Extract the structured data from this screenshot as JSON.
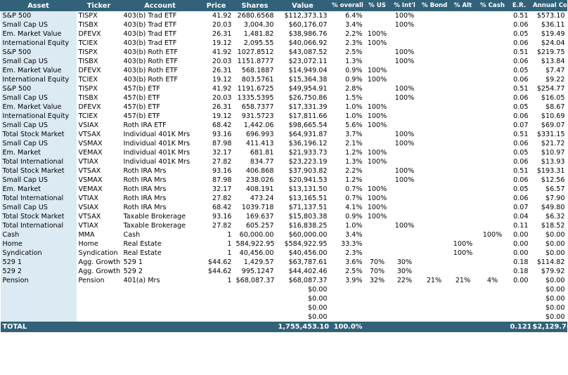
{
  "headers": [
    "Asset",
    "Ticker",
    "Account",
    "Price",
    "Shares",
    "Value",
    "% overall",
    "% US",
    "% Int'l",
    "% Bond",
    "% Alt",
    "% Cash",
    "E.R.",
    "Annual Cost"
  ],
  "rows": [
    [
      "S&P 500",
      "TISPX",
      "403(b) Trad ETF",
      "41.92",
      "2680.6568",
      "$112,373.13",
      "6.4%",
      "",
      "100%",
      "",
      "",
      "",
      "0.51",
      "$573.10"
    ],
    [
      "Small Cap US",
      "TISBX",
      "403(b) Trad ETF",
      "20.03",
      "3,004.30",
      "$60,176.07",
      "3.4%",
      "",
      "100%",
      "",
      "",
      "",
      "0.06",
      "$36.11"
    ],
    [
      "Em. Market Value",
      "DFEVX",
      "403(b) Trad ETF",
      "26.31",
      "1,481.82",
      "$38,986.76",
      "2.2%",
      "100%",
      "",
      "",
      "",
      "",
      "0.05",
      "$19.49"
    ],
    [
      "International Equity",
      "TCIEX",
      "403(b) Trad ETF",
      "19.12",
      "2,095.55",
      "$40,066.92",
      "2.3%",
      "100%",
      "",
      "",
      "",
      "",
      "0.06",
      "$24.04"
    ],
    [
      "S&P 500",
      "TISPX",
      "403(b) Roth ETF",
      "41.92",
      "1027.8512",
      "$43,087.52",
      "2.5%",
      "",
      "100%",
      "",
      "",
      "",
      "0.51",
      "$219.75"
    ],
    [
      "Small Cap US",
      "TISBX",
      "403(b) Roth ETF",
      "20.03",
      "1151.8777",
      "$23,072.11",
      "1.3%",
      "",
      "100%",
      "",
      "",
      "",
      "0.06",
      "$13.84"
    ],
    [
      "Em. Market Value",
      "DFEVX",
      "403(b) Roth ETF",
      "26.31",
      "568.1887",
      "$14,949.04",
      "0.9%",
      "100%",
      "",
      "",
      "",
      "",
      "0.05",
      "$7.47"
    ],
    [
      "International Equity",
      "TCIEX",
      "403(b) Roth ETF",
      "19.12",
      "803.5761",
      "$15,364.38",
      "0.9%",
      "100%",
      "",
      "",
      "",
      "",
      "0.06",
      "$9.22"
    ],
    [
      "S&P 500",
      "TISPX",
      "457(b) ETF",
      "41.92",
      "1191.6725",
      "$49,954.91",
      "2.8%",
      "",
      "100%",
      "",
      "",
      "",
      "0.51",
      "$254.77"
    ],
    [
      "Small Cap US",
      "TISBX",
      "457(b) ETF",
      "20.03",
      "1335.5395",
      "$26,750.86",
      "1.5%",
      "",
      "100%",
      "",
      "",
      "",
      "0.06",
      "$16.05"
    ],
    [
      "Em. Market Value",
      "DFEVX",
      "457(b) ETF",
      "26.31",
      "658.7377",
      "$17,331.39",
      "1.0%",
      "100%",
      "",
      "",
      "",
      "",
      "0.05",
      "$8.67"
    ],
    [
      "International Equity",
      "TCIEX",
      "457(b) ETF",
      "19.12",
      "931.5723",
      "$17,811.66",
      "1.0%",
      "100%",
      "",
      "",
      "",
      "",
      "0.06",
      "$10.69"
    ],
    [
      "Small Cap US",
      "VSIAX",
      "Roth IRA ETF",
      "68.42",
      "1,442.06",
      "$98,665.54",
      "5.6%",
      "100%",
      "",
      "",
      "",
      "",
      "0.07",
      "$69.07"
    ],
    [
      "Total Stock Market",
      "VTSAX",
      "Individual 401K Mrs",
      "93.16",
      "696.993",
      "$64,931.87",
      "3.7%",
      "",
      "100%",
      "",
      "",
      "",
      "0.51",
      "$331.15"
    ],
    [
      "Small Cap US",
      "VSMAX",
      "Individual 401K Mrs",
      "87.98",
      "411.413",
      "$36,196.12",
      "2.1%",
      "",
      "100%",
      "",
      "",
      "",
      "0.06",
      "$21.72"
    ],
    [
      "Em. Market",
      "VEMAX",
      "Individual 401K Mrs",
      "32.17",
      "681.81",
      "$21,933.73",
      "1.2%",
      "100%",
      "",
      "",
      "",
      "",
      "0.05",
      "$10.97"
    ],
    [
      "Total International",
      "VTIAX",
      "Individual 401K Mrs",
      "27.82",
      "834.77",
      "$23,223.19",
      "1.3%",
      "100%",
      "",
      "",
      "",
      "",
      "0.06",
      "$13.93"
    ],
    [
      "Total Stock Market",
      "VTSAX",
      "Roth IRA Mrs",
      "93.16",
      "406.868",
      "$37,903.82",
      "2.2%",
      "",
      "100%",
      "",
      "",
      "",
      "0.51",
      "$193.31"
    ],
    [
      "Small Cap US",
      "VSMAX",
      "Roth IRA Mrs",
      "87.98",
      "238.026",
      "$20,941.53",
      "1.2%",
      "",
      "100%",
      "",
      "",
      "",
      "0.06",
      "$12.56"
    ],
    [
      "Em. Market",
      "VEMAX",
      "Roth IRA Mrs",
      "32.17",
      "408.191",
      "$13,131.50",
      "0.7%",
      "100%",
      "",
      "",
      "",
      "",
      "0.05",
      "$6.57"
    ],
    [
      "Total International",
      "VTIAX",
      "Roth IRA Mrs",
      "27.82",
      "473.24",
      "$13,165.51",
      "0.7%",
      "100%",
      "",
      "",
      "",
      "",
      "0.06",
      "$7.90"
    ],
    [
      "Small Cap US",
      "VSIAX",
      "Roth IRA Mrs",
      "68.42",
      "1039.718",
      "$71,137.51",
      "4.1%",
      "100%",
      "",
      "",
      "",
      "",
      "0.07",
      "$49.80"
    ],
    [
      "Total Stock Market",
      "VTSAX",
      "Taxable Brokerage",
      "93.16",
      "169.637",
      "$15,803.38",
      "0.9%",
      "100%",
      "",
      "",
      "",
      "",
      "0.04",
      "$6.32"
    ],
    [
      "Total International",
      "VTIAX",
      "Taxable Brokerage",
      "27.82",
      "605.257",
      "$16,838.25",
      "1.0%",
      "",
      "100%",
      "",
      "",
      "",
      "0.11",
      "$18.52"
    ],
    [
      "Cash",
      "MMA",
      "Cash",
      "1",
      "60,000.00",
      "$60,000.00",
      "3.4%",
      "",
      "",
      "",
      "",
      "100%",
      "0.00",
      "$0.00"
    ],
    [
      "Home",
      "Home",
      "Real Estate",
      "1",
      "584,922.95",
      "$584,922.95",
      "33.3%",
      "",
      "",
      "",
      "100%",
      "",
      "0.00",
      "$0.00"
    ],
    [
      "Syndication",
      "Syndication",
      "Real Estate",
      "1",
      "40,456.00",
      "$40,456.00",
      "2.3%",
      "",
      "",
      "",
      "100%",
      "",
      "0.00",
      "$0.00"
    ],
    [
      "529 1",
      "Agg. Growth",
      "529 1",
      "$44.62",
      "1,429.57",
      "$63,787.61",
      "3.6%",
      "70%",
      "30%",
      "",
      "",
      "",
      "0.18",
      "$114.82"
    ],
    [
      "529 2",
      "Agg. Growth",
      "529 2",
      "$44.62",
      "995.1247",
      "$44,402.46",
      "2.5%",
      "70%",
      "30%",
      "",
      "",
      "",
      "0.18",
      "$79.92"
    ],
    [
      "Pension",
      "Pension",
      "401(a) Mrs",
      "1",
      "$68,087.37",
      "$68,087.37",
      "3.9%",
      "32%",
      "22%",
      "21%",
      "21%",
      "4%",
      "0.00",
      "$0.00"
    ],
    [
      "",
      "",
      "",
      "",
      "",
      "$0.00",
      "",
      "",
      "",
      "",
      "",
      "",
      "",
      "$0.00"
    ],
    [
      "",
      "",
      "",
      "",
      "",
      "$0.00",
      "",
      "",
      "",
      "",
      "",
      "",
      "",
      "$0.00"
    ],
    [
      "",
      "",
      "",
      "",
      "",
      "$0.00",
      "",
      "",
      "",
      "",
      "",
      "",
      "",
      "$0.00"
    ],
    [
      "",
      "",
      "",
      "",
      "",
      "$0.00",
      "",
      "",
      "",
      "",
      "",
      "",
      "",
      "$0.00"
    ]
  ],
  "total": {
    "label": "TOTAL",
    "value": "1,755,453.10",
    "overall": "100.0%",
    "er": "0.121",
    "cost": "$2,129.76"
  }
}
